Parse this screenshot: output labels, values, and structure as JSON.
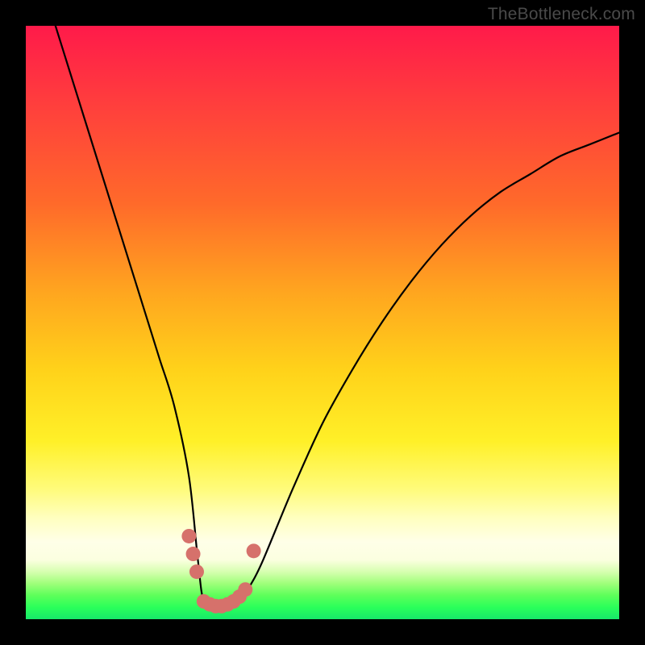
{
  "watermark": "TheBottleneck.com",
  "chart_data": {
    "type": "line",
    "title": "",
    "xlabel": "",
    "ylabel": "",
    "xlim": [
      0,
      100
    ],
    "ylim": [
      0,
      100
    ],
    "series": [
      {
        "name": "bottleneck-curve",
        "x": [
          5,
          7.5,
          10,
          12.5,
          15,
          17.5,
          20,
          22.5,
          25,
          27.5,
          29,
          30,
          32,
          34,
          36,
          38,
          40,
          45,
          50,
          55,
          60,
          65,
          70,
          75,
          80,
          85,
          90,
          95,
          100
        ],
        "values": [
          100,
          92,
          84,
          76,
          68,
          60,
          52,
          44,
          36,
          24,
          10,
          3,
          2,
          2,
          3,
          6,
          10,
          22,
          33,
          42,
          50,
          57,
          63,
          68,
          72,
          75,
          78,
          80,
          82
        ]
      }
    ],
    "markers": {
      "name": "highlight-dots",
      "color": "#d6716b",
      "points": [
        {
          "x": 27.5,
          "y": 14
        },
        {
          "x": 28.2,
          "y": 11
        },
        {
          "x": 28.8,
          "y": 8
        },
        {
          "x": 30.0,
          "y": 3
        },
        {
          "x": 31.0,
          "y": 2.5
        },
        {
          "x": 32.0,
          "y": 2.2
        },
        {
          "x": 33.0,
          "y": 2.2
        },
        {
          "x": 34.0,
          "y": 2.5
        },
        {
          "x": 35.0,
          "y": 3.0
        },
        {
          "x": 36.0,
          "y": 3.8
        },
        {
          "x": 37.0,
          "y": 5.0
        },
        {
          "x": 38.4,
          "y": 11.5
        }
      ]
    },
    "gradient_stops": [
      {
        "pos": 0,
        "color": "#ff1a4a"
      },
      {
        "pos": 50,
        "color": "#ffd21a"
      },
      {
        "pos": 90,
        "color": "#ffffe8"
      },
      {
        "pos": 100,
        "color": "#17e86a"
      }
    ]
  }
}
